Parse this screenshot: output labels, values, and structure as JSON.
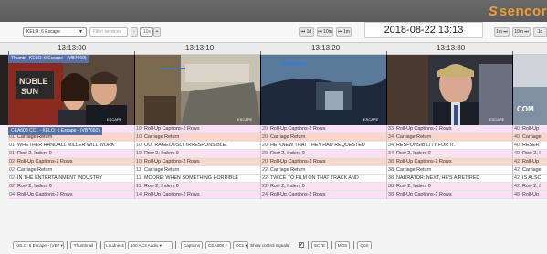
{
  "brand": {
    "name": "sencor"
  },
  "toolbar": {
    "source_select": "KELO: 6 Escape",
    "filter_placeholder": "Filter services",
    "minus": "-",
    "zoom": "10s",
    "plus": "+",
    "nav_buttons": [
      "⏮ 1d",
      "⏮ 10m",
      "⏮ 1m"
    ],
    "date": "2018-08-22 13:13",
    "nav_fwd": [
      "1m ⏭",
      "10m ⏭",
      "1d"
    ]
  },
  "ruler": {
    "labels": [
      "13:13:00",
      "13:13:10",
      "13:13:20",
      "13:13:30"
    ]
  },
  "thumbnails": {
    "label": "Thumb - KELO: 6 Escape - (VB7660)"
  },
  "captions": {
    "channel_label": "CEA608 CC1 - KELO: 6 Escape - (VB7660)",
    "columns": [
      {
        "rows": [
          {
            "n": "01",
            "t": "Carriage Return"
          },
          {
            "n": "01",
            "t": "WHETHER RANDALL MILLER WILL WORK"
          },
          {
            "n": "01",
            "t": "Row 2, Indent 0"
          },
          {
            "n": "02",
            "t": "Roll-Up Captions-2 Rows"
          },
          {
            "n": "02",
            "t": "Carriage Return"
          },
          {
            "n": "02",
            "t": "IN THE ENTERTAINMENT INDUSTRY"
          },
          {
            "n": "02",
            "t": "Row 2, Indent 0"
          },
          {
            "n": "04",
            "t": "Roll-Up Captions-2 Rows"
          }
        ]
      },
      {
        "rows": [
          {
            "n": "10",
            "t": "Roll-Up Captions-2 Rows"
          },
          {
            "n": "10",
            "t": "Carriage Return"
          },
          {
            "n": "10",
            "t": "OUTRAGEOUSLY IRRESPONSIBLE."
          },
          {
            "n": "10",
            "t": "Row 2, Indent 0"
          },
          {
            "n": "10",
            "t": "Roll-Up Captions-2 Rows"
          },
          {
            "n": "11",
            "t": "Carriage Return"
          },
          {
            "n": "11",
            "t": "MOORE: WHEN SOMETHING HORRIBLE"
          },
          {
            "n": "11",
            "t": "Row 2, Indent 0"
          },
          {
            "n": "14",
            "t": "Roll-Up Captions-2 Rows"
          }
        ]
      },
      {
        "rows": [
          {
            "n": "20",
            "t": "Roll-Up Captions-2 Rows"
          },
          {
            "n": "20",
            "t": "Carriage Return"
          },
          {
            "n": "20",
            "t": "HE KNEW THAT THEY HAD REQUESTED"
          },
          {
            "n": "20",
            "t": "Row 2, Indent 0"
          },
          {
            "n": "20",
            "t": "Roll-Up Captions-2 Rows"
          },
          {
            "n": "22",
            "t": "Carriage Return"
          },
          {
            "n": "22",
            "t": "TWICE TO FILM ON THAT TRACK AND"
          },
          {
            "n": "22",
            "t": "Row 2, Indent 0"
          },
          {
            "n": "24",
            "t": "Roll-Up Captions-2 Rows"
          }
        ]
      },
      {
        "rows": [
          {
            "n": "33",
            "t": "Roll-Up Captions-2 Rows"
          },
          {
            "n": "34",
            "t": "Carriage Return"
          },
          {
            "n": "34",
            "t": "RESPONSIBILITY FOR IT."
          },
          {
            "n": "34",
            "t": "Row 2, Indent 0"
          },
          {
            "n": "38",
            "t": "Roll-Up Captions-2 Rows"
          },
          {
            "n": "38",
            "t": "Carriage Return"
          },
          {
            "n": "38",
            "t": "NARRATOR: NEXT, HE'S A RETIRED"
          },
          {
            "n": "38",
            "t": "Row 2, Indent 0"
          },
          {
            "n": "38",
            "t": "Roll-Up Captions-2 Rows"
          }
        ]
      },
      {
        "rows": [
          {
            "n": "40",
            "t": "Roll-Up"
          },
          {
            "n": "40",
            "t": "Carriage"
          },
          {
            "n": "40",
            "t": "RESER"
          },
          {
            "n": "40",
            "t": "Row 2, I"
          },
          {
            "n": "42",
            "t": "Roll-Up"
          },
          {
            "n": "42",
            "t": "Carriage"
          },
          {
            "n": "42",
            "t": "IS ALSC"
          },
          {
            "n": "42",
            "t": "Row 2, I"
          },
          {
            "n": "48",
            "t": "Roll-Up"
          }
        ]
      }
    ],
    "row_colors": [
      "pink",
      "salmon",
      "white",
      "pink",
      "salmon",
      "white",
      "white",
      "pink",
      "pink"
    ]
  },
  "bottom": {
    "source_select": "KELO: 6 Escape - (VB7",
    "thumbnail": "Thumbnail",
    "loudness": "Loudness",
    "audio_select": "100 AC3 Audio",
    "captions": "Captions",
    "cea_select": "CEA608",
    "cc_select": "CC1",
    "show_control": "Show control signals",
    "show_control_checked": "✔",
    "scte": "SCTE",
    "mos": "MOS",
    "qos": "QoS"
  }
}
